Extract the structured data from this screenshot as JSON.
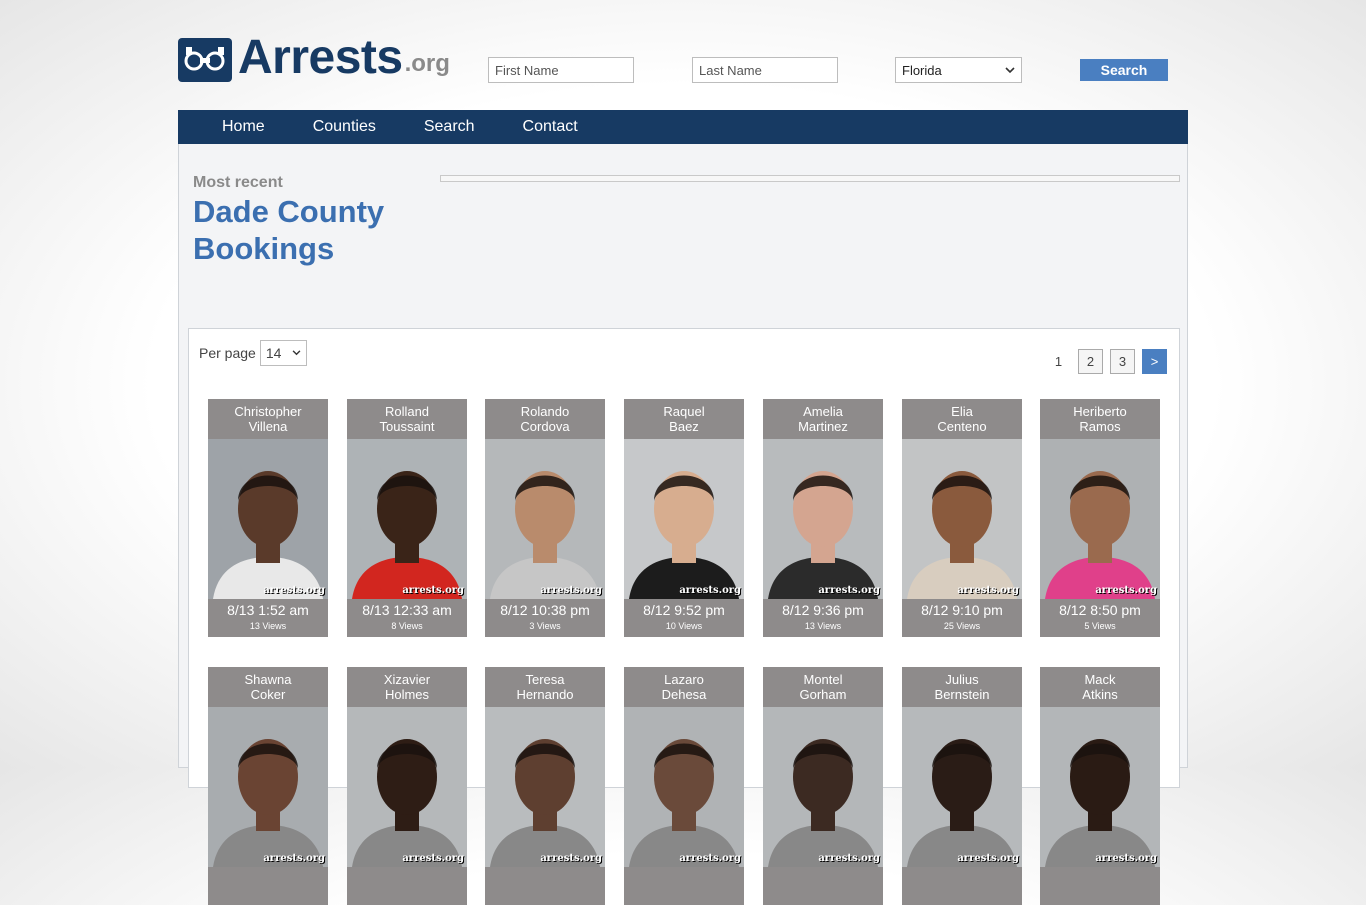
{
  "header": {
    "logo_text": "Arrests",
    "logo_ext": ".org",
    "first_name_placeholder": "First Name",
    "last_name_placeholder": "Last Name",
    "state_selected": "Florida",
    "search_label": "Search"
  },
  "nav": [
    "Home",
    "Counties",
    "Search",
    "Contact"
  ],
  "page": {
    "kicker": "Most recent",
    "title": "Dade County Bookings"
  },
  "listing": {
    "per_page_label": "Per page",
    "per_page_value": "14",
    "pages": [
      "1",
      "2",
      "3"
    ],
    "next_label": ">"
  },
  "watermark": "arrests.org",
  "bookings": [
    {
      "first": "Christopher",
      "last": "Villena",
      "time": "8/13 1:52 am",
      "views": "13 Views",
      "skin": "#5a3a2a",
      "shirt": "#e8e8e8",
      "bg": "#9ea3a8"
    },
    {
      "first": "Rolland",
      "last": "Toussaint",
      "time": "8/13 12:33 am",
      "views": "8 Views",
      "skin": "#3a2418",
      "shirt": "#d2261f",
      "bg": "#aeb3b6"
    },
    {
      "first": "Rolando",
      "last": "Cordova",
      "time": "8/12 10:38 pm",
      "views": "3 Views",
      "skin": "#b98b6c",
      "shirt": "#c6c6c6",
      "bg": "#b5b8ba"
    },
    {
      "first": "Raquel",
      "last": "Baez",
      "time": "8/12 9:52 pm",
      "views": "10 Views",
      "skin": "#d7ad8f",
      "shirt": "#1c1c1c",
      "bg": "#c6c8ca"
    },
    {
      "first": "Amelia",
      "last": "Martinez",
      "time": "8/12 9:36 pm",
      "views": "13 Views",
      "skin": "#d4a590",
      "shirt": "#2b2b2b",
      "bg": "#b8bbbd"
    },
    {
      "first": "Elia",
      "last": "Centeno",
      "time": "8/12 9:10 pm",
      "views": "25 Views",
      "skin": "#8a5a3d",
      "shirt": "#d8cdbf",
      "bg": "#c2c4c5"
    },
    {
      "first": "Heriberto",
      "last": "Ramos",
      "time": "8/12 8:50 pm",
      "views": "5 Views",
      "skin": "#9a6a4e",
      "shirt": "#e0408a",
      "bg": "#aeb1b3"
    },
    {
      "first": "Shawna",
      "last": "Coker",
      "time": "",
      "views": "",
      "skin": "#6a4433",
      "shirt": "#888",
      "bg": "#a8acaf"
    },
    {
      "first": "Xizavier",
      "last": "Holmes",
      "time": "",
      "views": "",
      "skin": "#2e1d15",
      "shirt": "#888",
      "bg": "#b5b8ba"
    },
    {
      "first": "Teresa",
      "last": "Hernando",
      "time": "",
      "views": "",
      "skin": "#5e3f30",
      "shirt": "#888",
      "bg": "#b9bcbe"
    },
    {
      "first": "Lazaro",
      "last": "Dehesa",
      "time": "",
      "views": "",
      "skin": "#6a4a3a",
      "shirt": "#888",
      "bg": "#b0b3b5"
    },
    {
      "first": "Montel",
      "last": "Gorham",
      "time": "",
      "views": "",
      "skin": "#3c2a22",
      "shirt": "#888",
      "bg": "#b4b7b9"
    },
    {
      "first": "Julius",
      "last": "Bernstein",
      "time": "",
      "views": "",
      "skin": "#2a1c16",
      "shirt": "#888",
      "bg": "#b6b9bb"
    },
    {
      "first": "Mack",
      "last": "Atkins",
      "time": "",
      "views": "",
      "skin": "#2a1b14",
      "shirt": "#888",
      "bg": "#b3b6b8"
    }
  ],
  "colors": {
    "brand_navy": "#173a63",
    "accent_blue": "#4a7fc1",
    "title_blue": "#3b6fb0",
    "card_gray": "#8e8b8b"
  }
}
